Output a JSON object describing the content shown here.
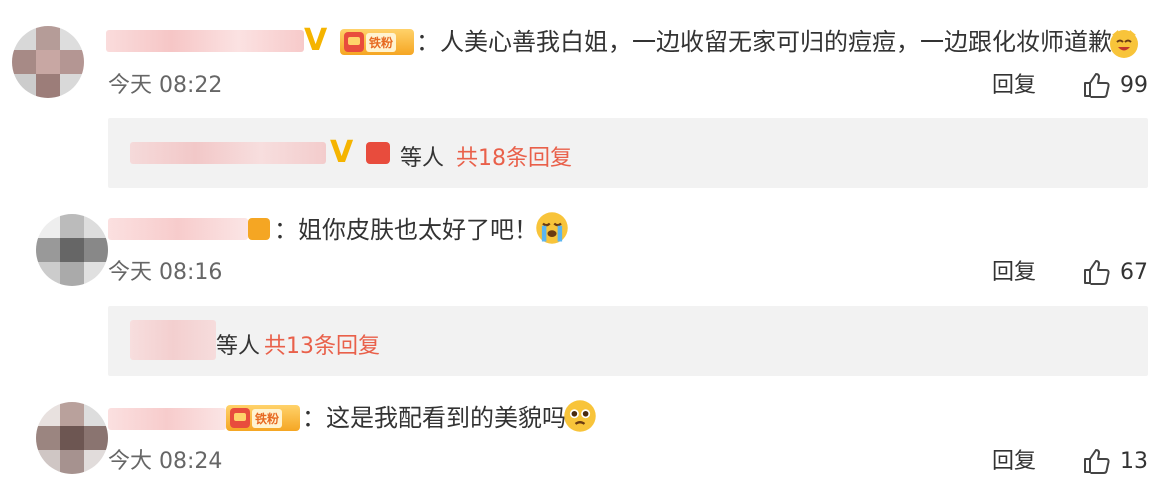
{
  "comments": [
    {
      "text": "：人美心善我白姐，一边收留无家可归的痘痘，一边跟化妆师道歉",
      "time": "今天 08:22",
      "reply_label": "回复",
      "likes": "99",
      "badge_tag": "铁粉",
      "thread": {
        "others": "等人",
        "more": "共18条回复"
      }
    },
    {
      "text": "：姐你皮肤也太好了吧！",
      "time": "今天 08:16",
      "reply_label": "回复",
      "likes": "67",
      "thread": {
        "others": "等人",
        "more": "共13条回复"
      }
    },
    {
      "text": "：这是我配看到的美貌吗",
      "time": "今大 08:24",
      "reply_label": "回复",
      "likes": "13",
      "badge_tag": "铁粉"
    }
  ],
  "colors": {
    "accent_reply_more": "#e9604a",
    "verified": "#f5b400",
    "badge": "#f5a623"
  },
  "icons": {
    "like": "thumbs-up-icon",
    "verified": "verified-v-icon",
    "fan_badge": "fan-badge-icon",
    "emoji_1": "laughing-emoji-icon",
    "emoji_2": "crying-emoji-icon",
    "emoji_3": "pleading-emoji-icon"
  }
}
